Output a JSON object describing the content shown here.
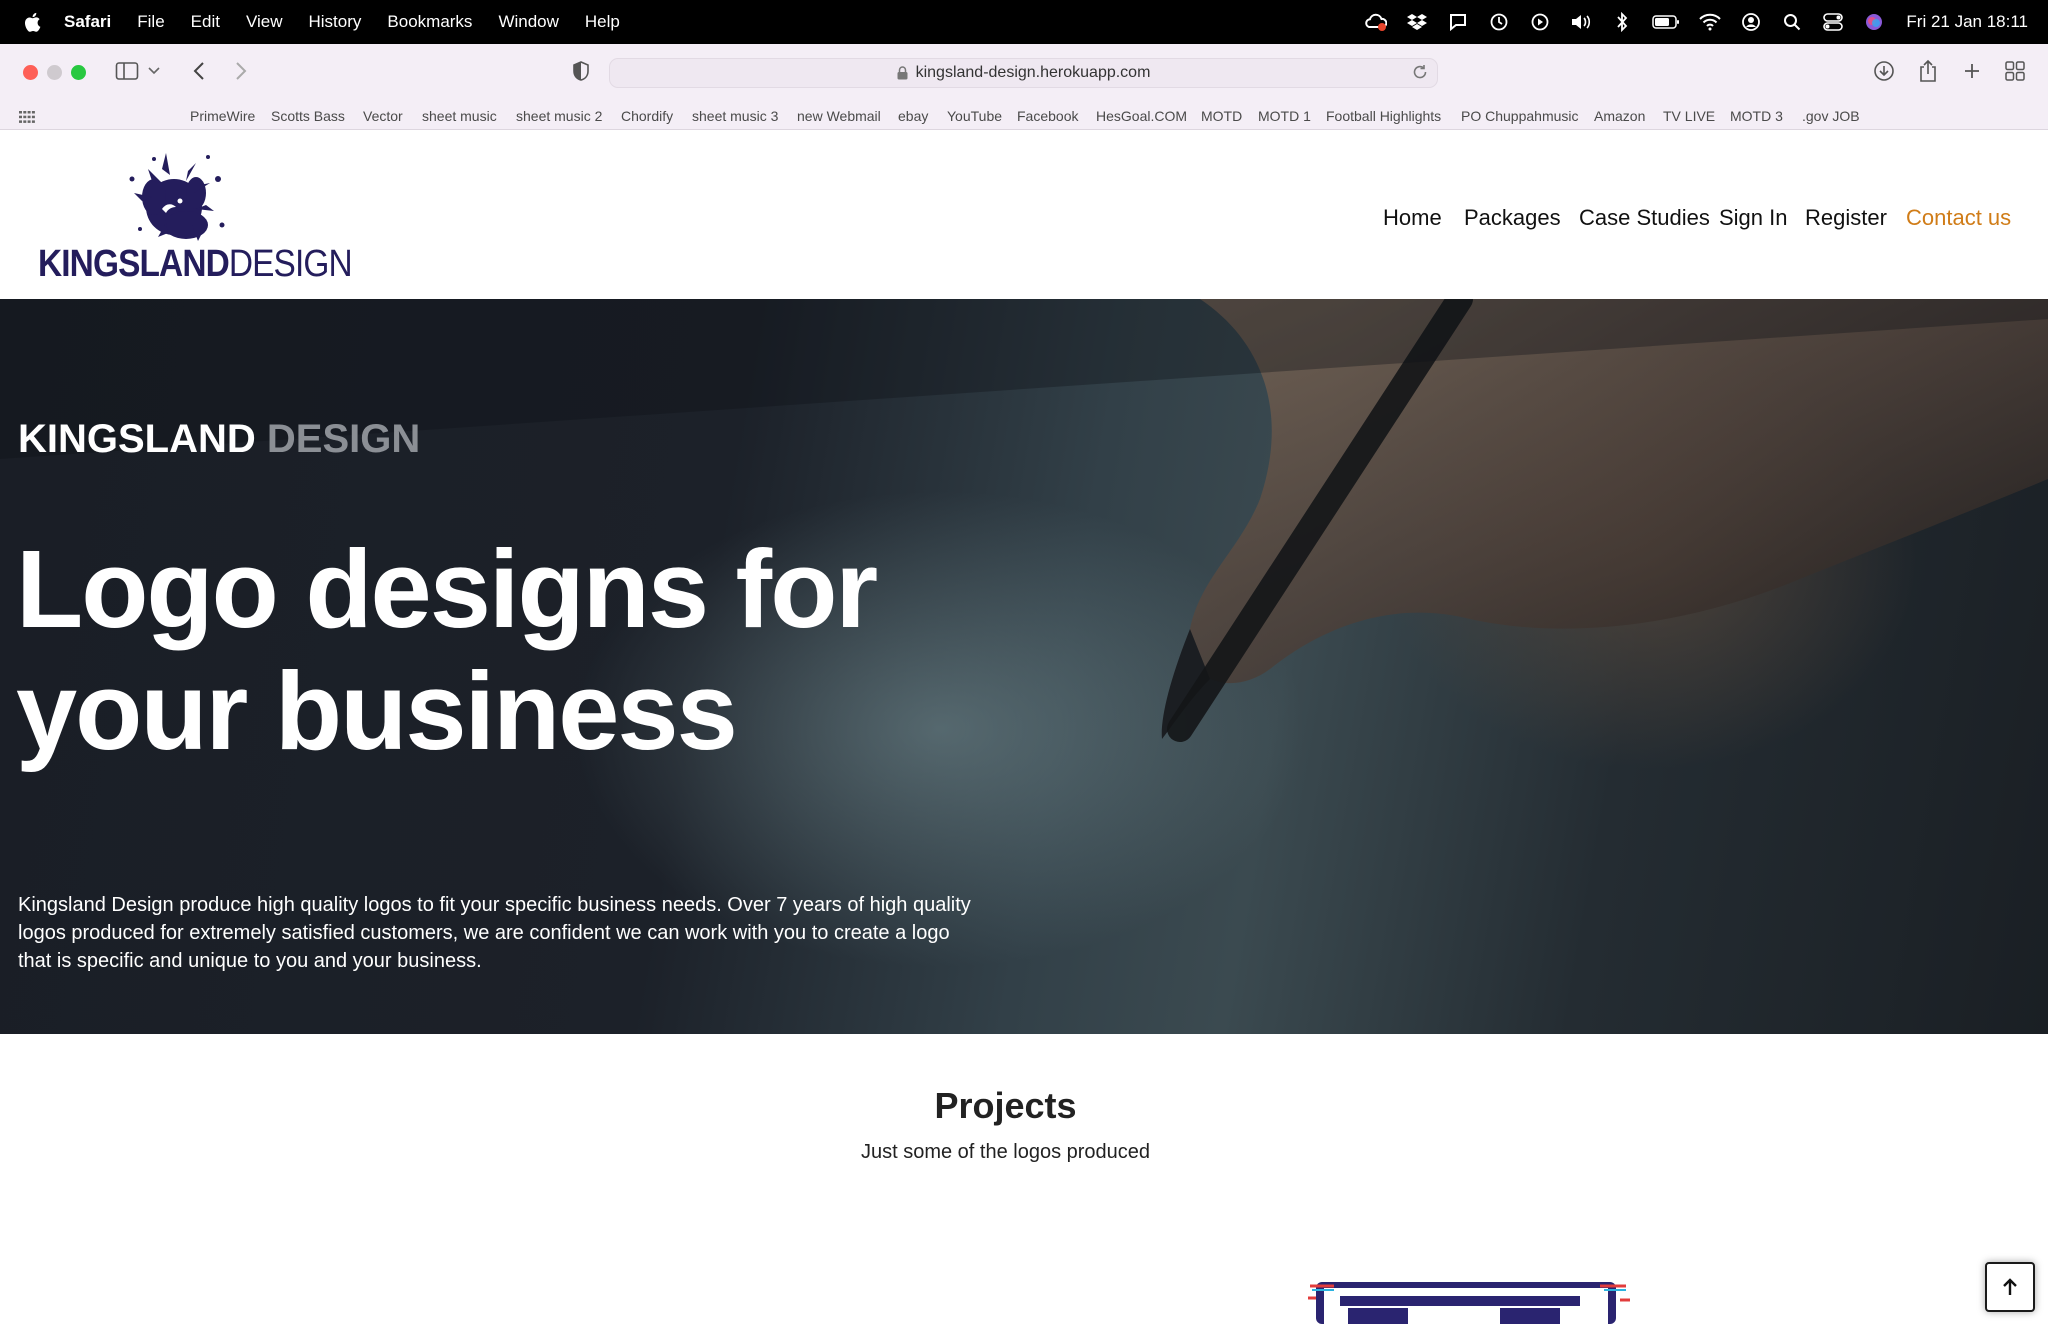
{
  "menubar": {
    "app_name": "Safari",
    "items": [
      "File",
      "Edit",
      "View",
      "History",
      "Bookmarks",
      "Window",
      "Help"
    ],
    "clock": "Fri 21 Jan  18:11"
  },
  "browser": {
    "url": "kingsland-design.herokuapp.com"
  },
  "bookmarks": [
    "PrimeWire",
    "Scotts Bass",
    "Vector",
    "sheet music",
    "sheet music 2",
    "Chordify",
    "sheet music 3",
    "new Webmail",
    "ebay",
    "YouTube",
    "Facebook",
    "HesGoal.COM",
    "MOTD",
    "MOTD 1",
    "Football Highlights",
    "PO Chuppahmusic",
    "Amazon",
    "TV LIVE",
    "MOTD 3",
    ".gov JOB"
  ],
  "site": {
    "logo": {
      "word1": "KINGSLAND",
      "word2": "DESIGN"
    },
    "nav": [
      {
        "label": "Home"
      },
      {
        "label": "Packages"
      },
      {
        "label": "Case Studies"
      },
      {
        "label": "Sign In"
      },
      {
        "label": "Register"
      },
      {
        "label": "Contact us"
      }
    ],
    "accent_color": "#d07c17",
    "brand_color": "#241d5c"
  },
  "hero": {
    "eyebrow_main": "KINGSLAND",
    "eyebrow_muted": "DESIGN",
    "headline_line1": "Logo designs for",
    "headline_line2": "your business",
    "intro": "Kingsland Design produce high quality logos to fit your specific business needs. Over 7 years of high quality logos produced for extremely satisfied customers, we are confident we can work with you to create a logo that is specific and unique to you and your business."
  },
  "projects": {
    "title": "Projects",
    "subtitle": "Just some of the logos produced"
  }
}
